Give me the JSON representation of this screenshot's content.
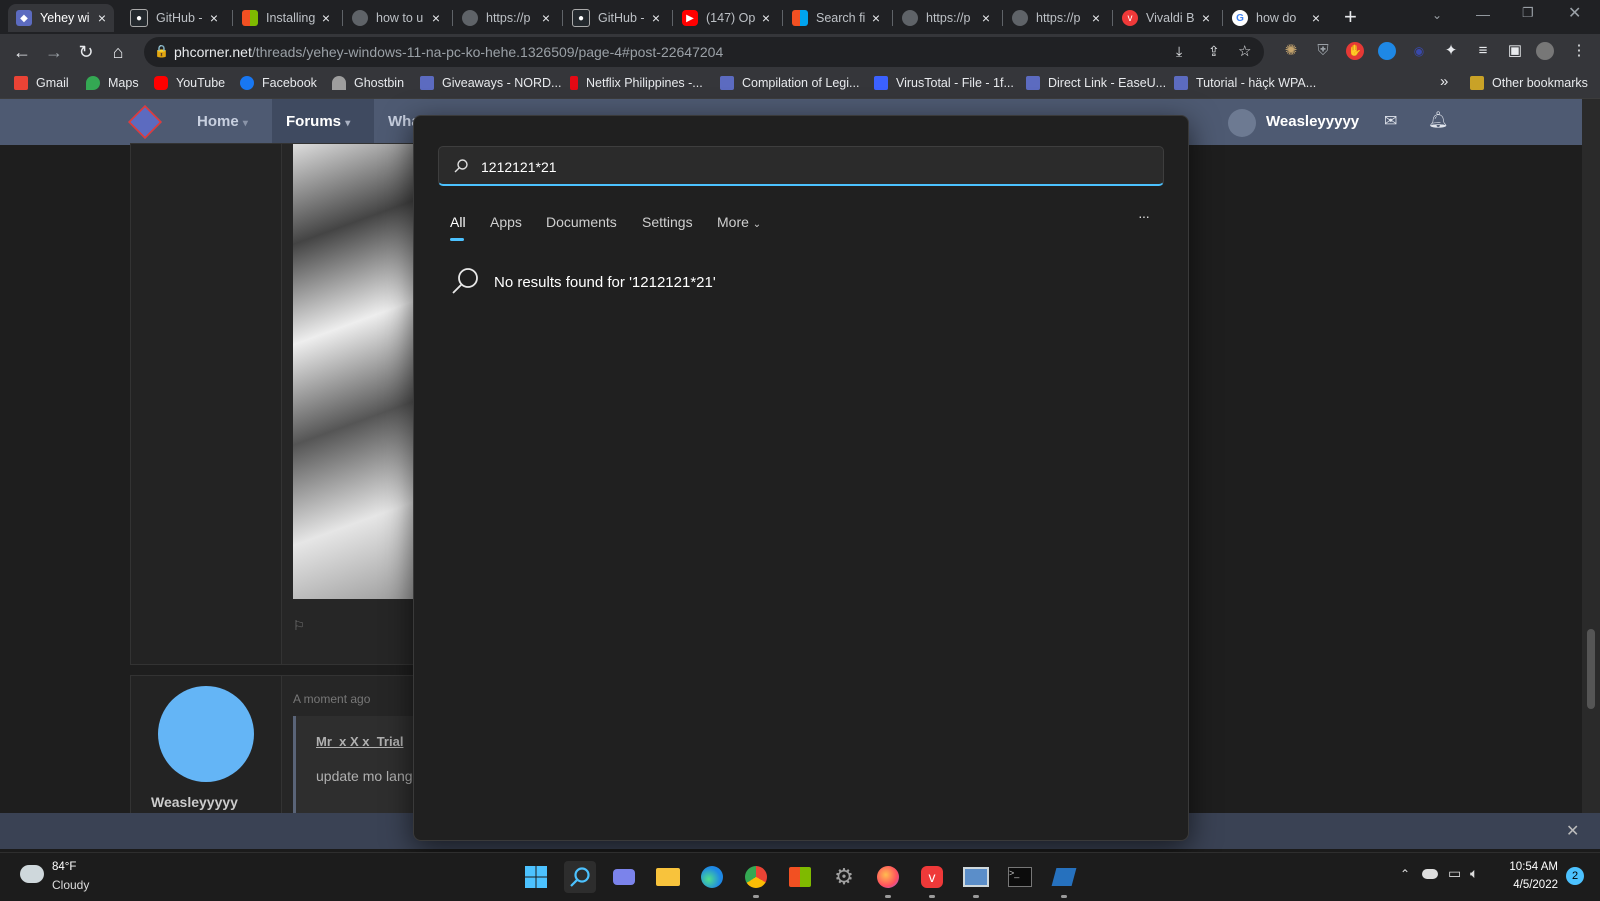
{
  "browser": {
    "tabs": [
      {
        "title": "Yehey wi",
        "icon": "phcorner-icon",
        "active": true
      },
      {
        "title": "GitHub -",
        "icon": "github-icon"
      },
      {
        "title": "Installing",
        "icon": "microsoft-icon"
      },
      {
        "title": "how to u",
        "icon": "globe-icon"
      },
      {
        "title": "https://p",
        "icon": "globe-icon"
      },
      {
        "title": "GitHub -",
        "icon": "github-icon"
      },
      {
        "title": "(147) Op",
        "icon": "youtube-icon"
      },
      {
        "title": "Search fi",
        "icon": "microsoft-icon"
      },
      {
        "title": "https://p",
        "icon": "globe-icon"
      },
      {
        "title": "https://p",
        "icon": "globe-icon"
      },
      {
        "title": "Vivaldi B",
        "icon": "vivaldi-icon"
      },
      {
        "title": "how do",
        "icon": "google-icon"
      }
    ],
    "new_tab": "+",
    "url_host": "phcorner.net",
    "url_path": "/threads/yehey-windows-11-na-pc-ko-hehe.1326509/page-4#post-22647204",
    "bookmarks": [
      {
        "label": "Gmail",
        "color": "#ea4335"
      },
      {
        "label": "Maps",
        "color": "#34a853"
      },
      {
        "label": "YouTube",
        "color": "#ff0000"
      },
      {
        "label": "Facebook",
        "color": "#1877f2"
      },
      {
        "label": "Ghostbin",
        "color": "#9e9e9e"
      },
      {
        "label": "Giveaways - NORD...",
        "color": "#5c6bc0"
      },
      {
        "label": "Netflix Philippines -...",
        "color": "#e50914"
      },
      {
        "label": "Compilation of Legi...",
        "color": "#5c6bc0"
      },
      {
        "label": "VirusTotal - File - 1f...",
        "color": "#3b61ff"
      },
      {
        "label": "Direct Link - EaseU...",
        "color": "#5c6bc0"
      },
      {
        "label": "Tutorial - häçk WPA...",
        "color": "#5c6bc0"
      }
    ],
    "bookmarks_more": "»",
    "other_bookmarks": "Other bookmarks"
  },
  "site": {
    "nav": [
      "Home",
      "Forums",
      "Wha"
    ],
    "username": "Weasleyyyyy",
    "post_time": "A moment ago",
    "quote_author": "Mr_x X x_Trial",
    "post_text": "update mo lang",
    "poster_name": "Weasleyyyyy"
  },
  "search": {
    "query": "1212121*21",
    "tabs": [
      "All",
      "Apps",
      "Documents",
      "Settings",
      "More"
    ],
    "active_tab": "All",
    "more_options": "···",
    "no_results": "No results found for '1212121*21'"
  },
  "taskbar": {
    "weather_temp": "84°F",
    "weather_desc": "Cloudy",
    "time": "10:54 AM",
    "date": "4/5/2022",
    "notification_count": "2",
    "apps": [
      "start-icon",
      "search-icon",
      "teams-icon",
      "file-explorer-icon",
      "edge-icon",
      "chrome-icon",
      "store-icon",
      "settings-icon",
      "firefox-icon",
      "vivaldi-icon",
      "remote-desktop-icon",
      "terminal-icon",
      "powershell-icon"
    ]
  },
  "colors": {
    "accent": "#4cc2ff",
    "site_header": "#4e5a72"
  }
}
